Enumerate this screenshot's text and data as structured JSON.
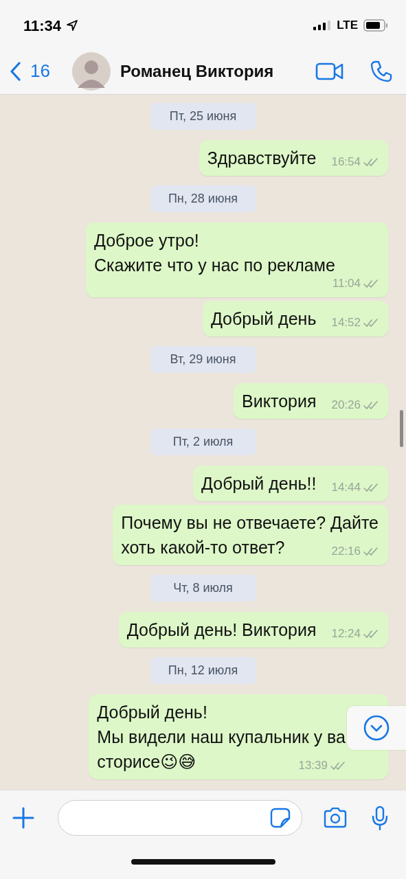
{
  "status_bar": {
    "time": "11:34",
    "network": "LTE"
  },
  "header": {
    "back_count": "16",
    "contact_name": "Романец Виктория"
  },
  "chat": [
    {
      "kind": "date",
      "text": "Пт, 25 июня"
    },
    {
      "kind": "message",
      "lines": [
        "Здравствуйте"
      ],
      "time": "16:54",
      "read": false
    },
    {
      "kind": "date",
      "text": "Пн, 28 июня"
    },
    {
      "kind": "message",
      "lines": [
        "Доброе утро!",
        "Скажите что у нас по рекламе"
      ],
      "time": "11:04",
      "read": false
    },
    {
      "kind": "message",
      "lines": [
        "Добрый день"
      ],
      "time": "14:52",
      "read": false
    },
    {
      "kind": "date",
      "text": "Вт, 29 июня"
    },
    {
      "kind": "message",
      "lines": [
        "Виктория"
      ],
      "time": "20:26",
      "read": false
    },
    {
      "kind": "date",
      "text": "Пт, 2 июля"
    },
    {
      "kind": "message",
      "lines": [
        "Добрый день!!"
      ],
      "time": "14:44",
      "read": false
    },
    {
      "kind": "message",
      "lines": [
        "Почему вы не отвечаете? Дайте",
        "хоть какой-то ответ?"
      ],
      "time": "22:16",
      "read": false
    },
    {
      "kind": "date",
      "text": "Чт, 8 июля"
    },
    {
      "kind": "message",
      "lines": [
        "Добрый день! Виктория"
      ],
      "time": "12:24",
      "read": false
    },
    {
      "kind": "date",
      "text": "Пн, 12 июля"
    },
    {
      "kind": "message",
      "lines": [
        "Добрый день!",
        "Мы видели наш купальник у ва",
        "сторисе😉😅"
      ],
      "time": "13:39",
      "read": false
    }
  ]
}
